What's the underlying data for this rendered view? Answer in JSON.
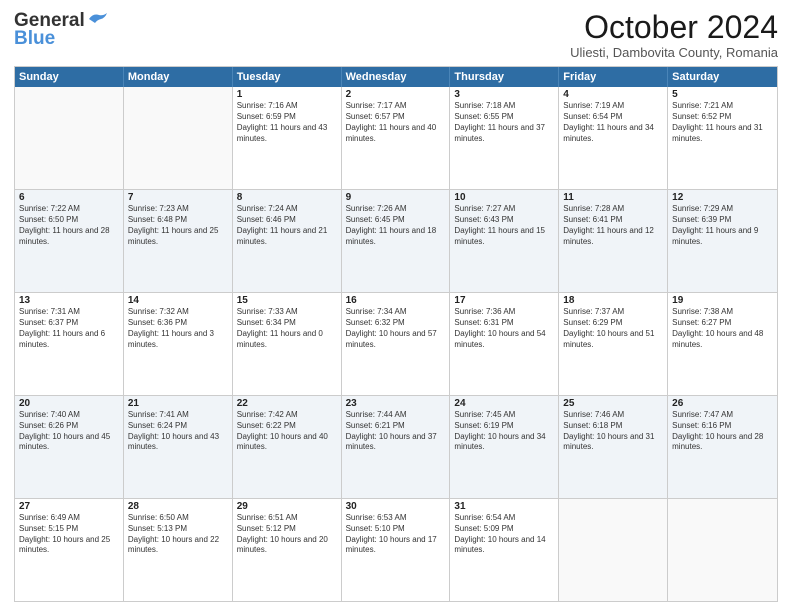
{
  "header": {
    "logo_general": "General",
    "logo_blue": "Blue",
    "month_title": "October 2024",
    "subtitle": "Uliesti, Dambovita County, Romania"
  },
  "weekdays": [
    "Sunday",
    "Monday",
    "Tuesday",
    "Wednesday",
    "Thursday",
    "Friday",
    "Saturday"
  ],
  "rows": [
    [
      {
        "day": "",
        "info": ""
      },
      {
        "day": "",
        "info": ""
      },
      {
        "day": "1",
        "info": "Sunrise: 7:16 AM\nSunset: 6:59 PM\nDaylight: 11 hours and 43 minutes."
      },
      {
        "day": "2",
        "info": "Sunrise: 7:17 AM\nSunset: 6:57 PM\nDaylight: 11 hours and 40 minutes."
      },
      {
        "day": "3",
        "info": "Sunrise: 7:18 AM\nSunset: 6:55 PM\nDaylight: 11 hours and 37 minutes."
      },
      {
        "day": "4",
        "info": "Sunrise: 7:19 AM\nSunset: 6:54 PM\nDaylight: 11 hours and 34 minutes."
      },
      {
        "day": "5",
        "info": "Sunrise: 7:21 AM\nSunset: 6:52 PM\nDaylight: 11 hours and 31 minutes."
      }
    ],
    [
      {
        "day": "6",
        "info": "Sunrise: 7:22 AM\nSunset: 6:50 PM\nDaylight: 11 hours and 28 minutes."
      },
      {
        "day": "7",
        "info": "Sunrise: 7:23 AM\nSunset: 6:48 PM\nDaylight: 11 hours and 25 minutes."
      },
      {
        "day": "8",
        "info": "Sunrise: 7:24 AM\nSunset: 6:46 PM\nDaylight: 11 hours and 21 minutes."
      },
      {
        "day": "9",
        "info": "Sunrise: 7:26 AM\nSunset: 6:45 PM\nDaylight: 11 hours and 18 minutes."
      },
      {
        "day": "10",
        "info": "Sunrise: 7:27 AM\nSunset: 6:43 PM\nDaylight: 11 hours and 15 minutes."
      },
      {
        "day": "11",
        "info": "Sunrise: 7:28 AM\nSunset: 6:41 PM\nDaylight: 11 hours and 12 minutes."
      },
      {
        "day": "12",
        "info": "Sunrise: 7:29 AM\nSunset: 6:39 PM\nDaylight: 11 hours and 9 minutes."
      }
    ],
    [
      {
        "day": "13",
        "info": "Sunrise: 7:31 AM\nSunset: 6:37 PM\nDaylight: 11 hours and 6 minutes."
      },
      {
        "day": "14",
        "info": "Sunrise: 7:32 AM\nSunset: 6:36 PM\nDaylight: 11 hours and 3 minutes."
      },
      {
        "day": "15",
        "info": "Sunrise: 7:33 AM\nSunset: 6:34 PM\nDaylight: 11 hours and 0 minutes."
      },
      {
        "day": "16",
        "info": "Sunrise: 7:34 AM\nSunset: 6:32 PM\nDaylight: 10 hours and 57 minutes."
      },
      {
        "day": "17",
        "info": "Sunrise: 7:36 AM\nSunset: 6:31 PM\nDaylight: 10 hours and 54 minutes."
      },
      {
        "day": "18",
        "info": "Sunrise: 7:37 AM\nSunset: 6:29 PM\nDaylight: 10 hours and 51 minutes."
      },
      {
        "day": "19",
        "info": "Sunrise: 7:38 AM\nSunset: 6:27 PM\nDaylight: 10 hours and 48 minutes."
      }
    ],
    [
      {
        "day": "20",
        "info": "Sunrise: 7:40 AM\nSunset: 6:26 PM\nDaylight: 10 hours and 45 minutes."
      },
      {
        "day": "21",
        "info": "Sunrise: 7:41 AM\nSunset: 6:24 PM\nDaylight: 10 hours and 43 minutes."
      },
      {
        "day": "22",
        "info": "Sunrise: 7:42 AM\nSunset: 6:22 PM\nDaylight: 10 hours and 40 minutes."
      },
      {
        "day": "23",
        "info": "Sunrise: 7:44 AM\nSunset: 6:21 PM\nDaylight: 10 hours and 37 minutes."
      },
      {
        "day": "24",
        "info": "Sunrise: 7:45 AM\nSunset: 6:19 PM\nDaylight: 10 hours and 34 minutes."
      },
      {
        "day": "25",
        "info": "Sunrise: 7:46 AM\nSunset: 6:18 PM\nDaylight: 10 hours and 31 minutes."
      },
      {
        "day": "26",
        "info": "Sunrise: 7:47 AM\nSunset: 6:16 PM\nDaylight: 10 hours and 28 minutes."
      }
    ],
    [
      {
        "day": "27",
        "info": "Sunrise: 6:49 AM\nSunset: 5:15 PM\nDaylight: 10 hours and 25 minutes."
      },
      {
        "day": "28",
        "info": "Sunrise: 6:50 AM\nSunset: 5:13 PM\nDaylight: 10 hours and 22 minutes."
      },
      {
        "day": "29",
        "info": "Sunrise: 6:51 AM\nSunset: 5:12 PM\nDaylight: 10 hours and 20 minutes."
      },
      {
        "day": "30",
        "info": "Sunrise: 6:53 AM\nSunset: 5:10 PM\nDaylight: 10 hours and 17 minutes."
      },
      {
        "day": "31",
        "info": "Sunrise: 6:54 AM\nSunset: 5:09 PM\nDaylight: 10 hours and 14 minutes."
      },
      {
        "day": "",
        "info": ""
      },
      {
        "day": "",
        "info": ""
      }
    ]
  ]
}
